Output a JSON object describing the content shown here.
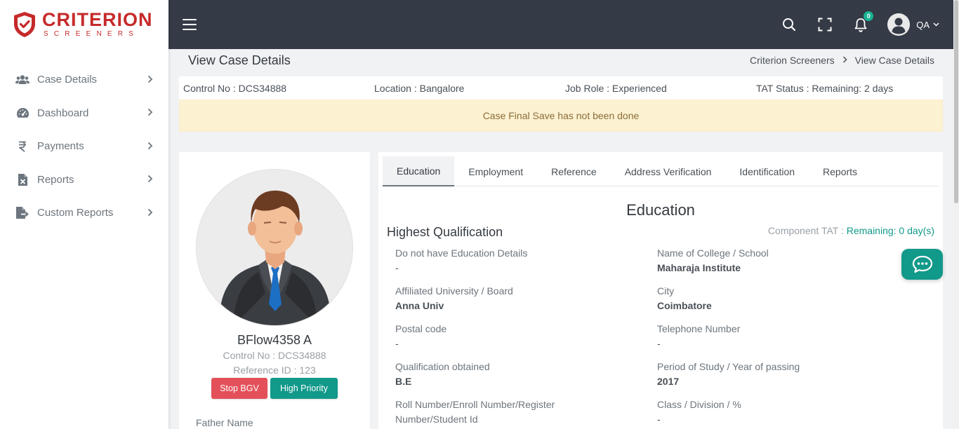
{
  "brand": {
    "name": "CRITERION",
    "tagline": "SCREENERS",
    "color": "#c62a2a"
  },
  "sidebar": {
    "items": [
      {
        "label": "Case Details",
        "icon": "users-icon"
      },
      {
        "label": "Dashboard",
        "icon": "dashboard-gauge-icon"
      },
      {
        "label": "Payments",
        "icon": "rupee-icon"
      },
      {
        "label": "Reports",
        "icon": "excel-file-icon"
      },
      {
        "label": "Custom Reports",
        "icon": "file-export-icon"
      }
    ]
  },
  "topbar": {
    "notification_count": "0",
    "user_initials": "QA"
  },
  "page": {
    "title": "View Case Details",
    "breadcrumb": [
      "Criterion Screeners",
      "View Case Details"
    ]
  },
  "case_info": {
    "control_no": "Control No : DCS34888",
    "location": "Location : Bangalore",
    "job_role": "Job Role : Experienced",
    "tat_status": "TAT Status : Remaining: 2 days"
  },
  "alert": {
    "message": "Case Final Save has not been done"
  },
  "profile": {
    "name": "BFlow4358 A",
    "control_no": "Control No : DCS34888",
    "reference_id": "Reference ID : 123",
    "stop_button": "Stop BGV",
    "priority_button": "High Priority",
    "father_label": "Father Name"
  },
  "tabs": [
    "Education",
    "Employment",
    "Reference",
    "Address Verification",
    "Identification",
    "Reports"
  ],
  "education": {
    "heading": "Education",
    "subheading": "Highest Qualification",
    "tat_label": "Component TAT :",
    "tat_value": "Remaining: 0 day(s)",
    "fields": [
      {
        "label": "Do not have Education Details",
        "value": "-"
      },
      {
        "label": "Name of College / School",
        "value": "Maharaja Institute"
      },
      {
        "label": "Affiliated University / Board",
        "value": "Anna Univ"
      },
      {
        "label": "City",
        "value": "Coimbatore"
      },
      {
        "label": "Postal code",
        "value": "-"
      },
      {
        "label": "Telephone Number",
        "value": "-"
      },
      {
        "label": "Qualification obtained",
        "value": "B.E"
      },
      {
        "label": "Period of Study / Year of passing",
        "value": "2017"
      },
      {
        "label": "Roll Number/Enroll Number/Register Number/Student Id",
        "value": ""
      },
      {
        "label": "Class / Division / %",
        "value": "-"
      }
    ]
  },
  "colors": {
    "accent": "#11998a",
    "danger": "#e4505a",
    "topbar": "#343a46",
    "alert_bg": "#fcf1d0"
  }
}
